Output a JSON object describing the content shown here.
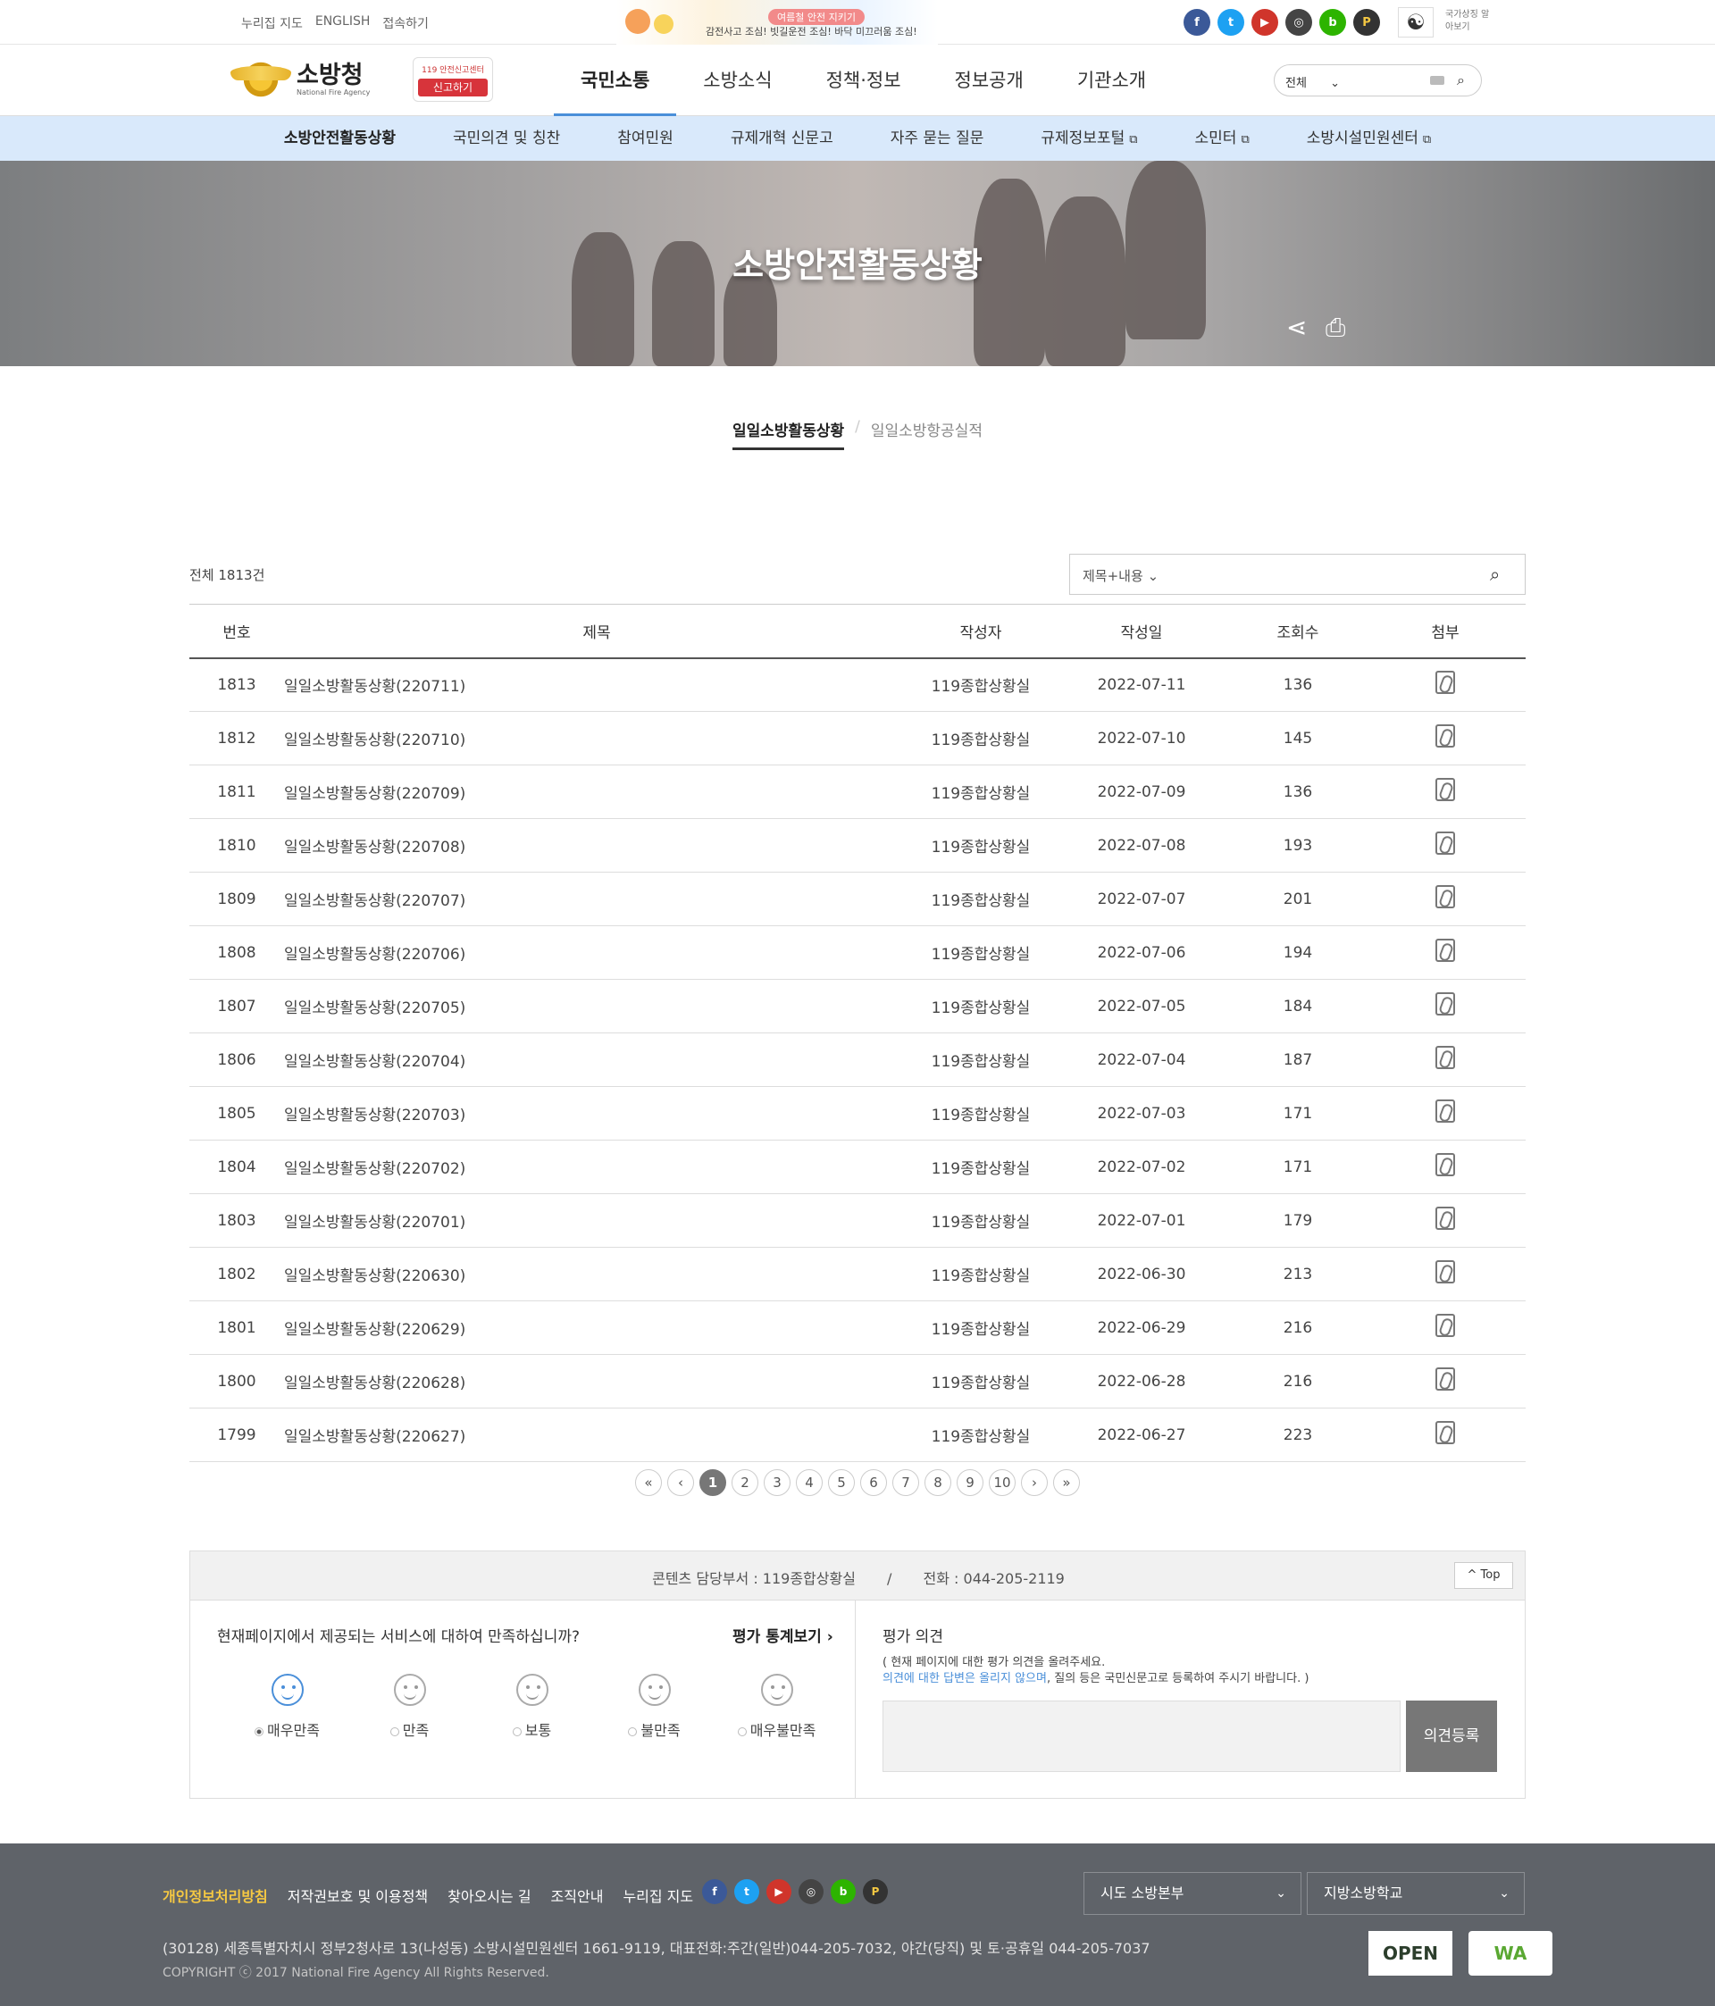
{
  "util": {
    "links": [
      "누리집 지도",
      "ENGLISH",
      "접속하기"
    ],
    "banner_tag": "여름철 안전 지키기",
    "banner_text": "감전사고 조심! 빗길운전 조심! 바닥 미끄러움 조심!",
    "sns": [
      {
        "label": "f",
        "icon": "facebook-icon",
        "color": "#3b5998"
      },
      {
        "label": "t",
        "icon": "twitter-icon",
        "color": "#1da1f2"
      },
      {
        "label": "▶",
        "icon": "youtube-icon",
        "color": "#d0352b"
      },
      {
        "label": "◎",
        "icon": "instagram-icon",
        "color": "#444444"
      },
      {
        "label": "b",
        "icon": "blog-icon",
        "color": "#2db400"
      },
      {
        "label": "P",
        "icon": "post-icon",
        "color": "#333333"
      }
    ],
    "national_symbol": "국가상징 알아보기"
  },
  "header": {
    "logo_name": "소방청",
    "logo_sub": "National Fire Agency",
    "report_top": "119 안전신고센터",
    "report_btn": "신고하기",
    "nav": [
      {
        "label": "국민소통",
        "active": true
      },
      {
        "label": "소방소식",
        "active": false
      },
      {
        "label": "정책·정보",
        "active": false
      },
      {
        "label": "정보공개",
        "active": false
      },
      {
        "label": "기관소개",
        "active": false
      }
    ],
    "search_scope": "전체"
  },
  "subnav": [
    {
      "label": "소방안전활동상황",
      "active": true,
      "external": false
    },
    {
      "label": "국민의견 및 칭찬",
      "active": false,
      "external": false
    },
    {
      "label": "참여민원",
      "active": false,
      "external": false
    },
    {
      "label": "규제개혁 신문고",
      "active": false,
      "external": false
    },
    {
      "label": "자주 묻는 질문",
      "active": false,
      "external": false
    },
    {
      "label": "규제정보포털",
      "active": false,
      "external": true
    },
    {
      "label": "소민터",
      "active": false,
      "external": true
    },
    {
      "label": "소방시설민원센터",
      "active": false,
      "external": true
    }
  ],
  "visual": {
    "title": "소방안전활동상황"
  },
  "tabs": [
    {
      "label": "일일소방활동상황",
      "active": true
    },
    {
      "label": "일일소방항공실적",
      "active": false
    }
  ],
  "list": {
    "total_label": "전체",
    "total_count": "1813건",
    "search_scope": "제목+내용",
    "columns": [
      "번호",
      "제목",
      "작성자",
      "작성일",
      "조회수",
      "첨부"
    ],
    "rows": [
      {
        "no": "1813",
        "title": "일일소방활동상황(220711)",
        "author": "119종합상황실",
        "date": "2022-07-11",
        "views": "136"
      },
      {
        "no": "1812",
        "title": "일일소방활동상황(220710)",
        "author": "119종합상황실",
        "date": "2022-07-10",
        "views": "145"
      },
      {
        "no": "1811",
        "title": "일일소방활동상황(220709)",
        "author": "119종합상황실",
        "date": "2022-07-09",
        "views": "136"
      },
      {
        "no": "1810",
        "title": "일일소방활동상황(220708)",
        "author": "119종합상황실",
        "date": "2022-07-08",
        "views": "193"
      },
      {
        "no": "1809",
        "title": "일일소방활동상황(220707)",
        "author": "119종합상황실",
        "date": "2022-07-07",
        "views": "201"
      },
      {
        "no": "1808",
        "title": "일일소방활동상황(220706)",
        "author": "119종합상황실",
        "date": "2022-07-06",
        "views": "194"
      },
      {
        "no": "1807",
        "title": "일일소방활동상황(220705)",
        "author": "119종합상황실",
        "date": "2022-07-05",
        "views": "184"
      },
      {
        "no": "1806",
        "title": "일일소방활동상황(220704)",
        "author": "119종합상황실",
        "date": "2022-07-04",
        "views": "187"
      },
      {
        "no": "1805",
        "title": "일일소방활동상황(220703)",
        "author": "119종합상황실",
        "date": "2022-07-03",
        "views": "171"
      },
      {
        "no": "1804",
        "title": "일일소방활동상황(220702)",
        "author": "119종합상황실",
        "date": "2022-07-02",
        "views": "171"
      },
      {
        "no": "1803",
        "title": "일일소방활동상황(220701)",
        "author": "119종합상황실",
        "date": "2022-07-01",
        "views": "179"
      },
      {
        "no": "1802",
        "title": "일일소방활동상황(220630)",
        "author": "119종합상황실",
        "date": "2022-06-30",
        "views": "213"
      },
      {
        "no": "1801",
        "title": "일일소방활동상황(220629)",
        "author": "119종합상황실",
        "date": "2022-06-29",
        "views": "216"
      },
      {
        "no": "1800",
        "title": "일일소방활동상황(220628)",
        "author": "119종합상황실",
        "date": "2022-06-28",
        "views": "216"
      },
      {
        "no": "1799",
        "title": "일일소방활동상황(220627)",
        "author": "119종합상황실",
        "date": "2022-06-27",
        "views": "223"
      }
    ]
  },
  "pager": {
    "pages": [
      "1",
      "2",
      "3",
      "4",
      "5",
      "6",
      "7",
      "8",
      "9",
      "10"
    ],
    "current": "1"
  },
  "info": {
    "dept": "콘텐츠 담당부서 : 119종합상황실",
    "sep": "/",
    "phone": "전화 : 044-205-2119",
    "top": "Top"
  },
  "satisfaction": {
    "question": "현재페이지에서 제공되는 서비스에 대하여 만족하십니까?",
    "stat_link": "평가 통계보기",
    "options": [
      {
        "label": "매우만족",
        "selected": true
      },
      {
        "label": "만족",
        "selected": false
      },
      {
        "label": "보통",
        "selected": false
      },
      {
        "label": "불만족",
        "selected": false
      },
      {
        "label": "매우불만족",
        "selected": false
      }
    ]
  },
  "opinion": {
    "heading": "평가 의견",
    "desc1": "( 현재 페이지에 대한 평가 의견을 올려주세요.",
    "desc2_em": "의견에 대한 답변은 올리지 않으며",
    "desc2_rest": ", 질의 등은 국민신문고로 등록하여 주시기 바랍니다. )",
    "button": "의견등록"
  },
  "footer": {
    "links": [
      "개인정보처리방침",
      "저작권보호 및 이용정책",
      "찾아오시는 길",
      "조직안내",
      "누리집 지도"
    ],
    "select1": "시도 소방본부",
    "select2": "지방소방학교",
    "address": "(30128) 세종특별자치시 정부2청사로 13(나성동) 소방시설민원센터 1661-9119, 대표전화:주간(일반)044-205-7032, 야간(당직) 및 토·공휴일 044-205-7037",
    "copyright": "COPYRIGHT ⓒ 2017 National Fire Agency All Rights Reserved.",
    "mark1": "OPEN",
    "mark2": "WA"
  }
}
